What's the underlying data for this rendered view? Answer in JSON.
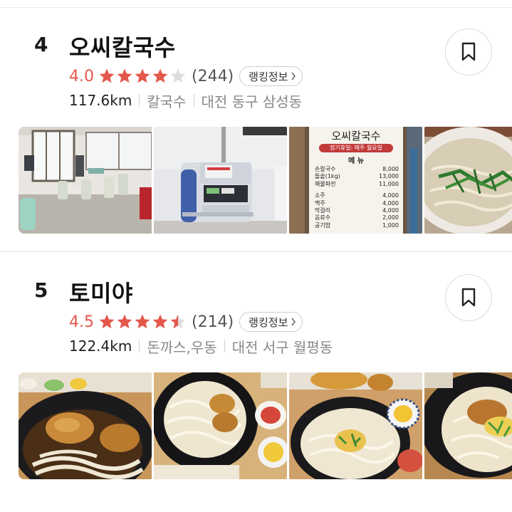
{
  "results": [
    {
      "rank": "4",
      "name": "오씨칼국수",
      "score": "4.0",
      "rating_value": 4.0,
      "review_count": "(244)",
      "ranking_button": "랭킹정보",
      "distance": "117.6km",
      "category": "칼국수",
      "address": "대전 동구 삼성동",
      "photos": [
        "dining-room-photo",
        "order-kiosk-photo",
        "menu-board-photo",
        "noodle-soup-photo"
      ],
      "menu_board": {
        "title": "오씨칼국수",
        "notice": "정기휴일: 매주 월요일",
        "heading": "메 뉴",
        "items": [
          {
            "name": "손칼국수",
            "price": "8,000"
          },
          {
            "name": "돌솥(1kg)",
            "price": "13,000"
          },
          {
            "name": "해물파전",
            "price": "11,000"
          },
          {
            "name": "소주",
            "price": "4,000"
          },
          {
            "name": "맥주",
            "price": "4,000"
          },
          {
            "name": "막걸리",
            "price": "4,000"
          },
          {
            "name": "음료수",
            "price": "2,000"
          },
          {
            "name": "공기밥",
            "price": "1,000"
          }
        ]
      }
    },
    {
      "rank": "5",
      "name": "토미야",
      "score": "4.5",
      "rating_value": 4.5,
      "review_count": "(214)",
      "ranking_button": "랭킹정보",
      "distance": "122.4km",
      "category": "돈까스,우동",
      "address": "대전 서구 월평동",
      "photos": [
        "udon-tempura-photo",
        "udon-bowl-photo",
        "udon-topped-photo",
        "udon-closeup-photo"
      ]
    }
  ],
  "colors": {
    "score": "#e4574b",
    "star_filled": "#e4574b",
    "star_empty": "#dcdcdc",
    "muted_text": "#888888",
    "divider": "#e9e9e9"
  },
  "icons": {
    "bookmark": "bookmark-icon",
    "star": "star-icon",
    "chevron": "chevron-right-icon"
  }
}
